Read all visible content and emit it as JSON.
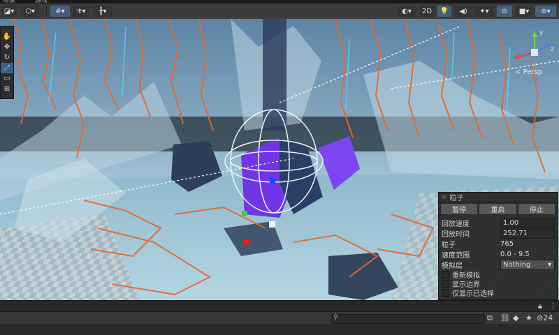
{
  "tabs": [
    "场景",
    "游戏"
  ],
  "scene_toolbar": {
    "draw_mode_icon": "shading-mode-icon",
    "button_2d": "2D"
  },
  "gizmo": {
    "axis_y": "y",
    "axis_z": "z",
    "projection": "< Persp"
  },
  "particle_overlay": {
    "title": "粒子",
    "buttons": {
      "pause": "暂停",
      "restart": "重启",
      "stop": "停止"
    },
    "playback_speed": {
      "label": "回放速度",
      "value": "1.00"
    },
    "playback_time": {
      "label": "回放时间",
      "value": "252.71"
    },
    "particles": {
      "label": "粒子",
      "value": "765"
    },
    "speed_range": {
      "label": "速度范围",
      "value": "0.0 - 9.5"
    },
    "simulate_layers": {
      "label": "模拟层",
      "value": "Nothing"
    },
    "checkboxes": {
      "resimulate": "重新模拟",
      "show_bounds": "显示边界",
      "show_only_selected": "仅显示已选择"
    }
  },
  "project_bar": {
    "search_placeholder": "",
    "hidden_count": "24"
  },
  "colors": {
    "accent_orange": "#e8662a",
    "accent_purple": "#7a3cf0",
    "sky_blue": "#86a8c2"
  }
}
